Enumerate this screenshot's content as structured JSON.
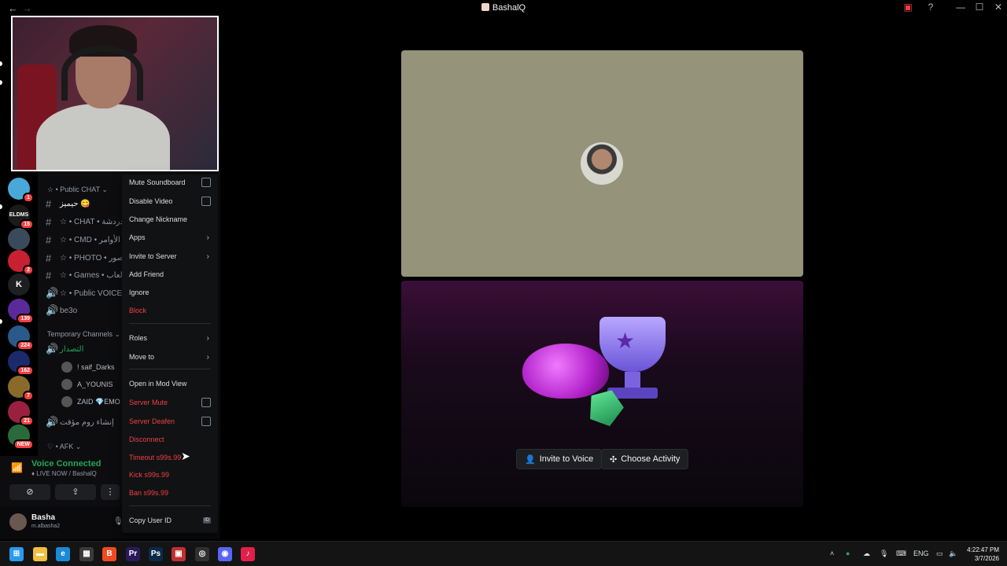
{
  "window": {
    "title": "BashalQ",
    "back_glyph": "←",
    "forward_glyph": "→",
    "controls": {
      "inbox_icon": "inbox-icon",
      "help": "?",
      "minimize": "—",
      "maximize": "☐",
      "close": "✕"
    }
  },
  "servers": [
    {
      "name": "server-1",
      "color": "#4aa8d8",
      "badge": "1"
    },
    {
      "name": "server-2",
      "color": "#1a1a1a",
      "label": "ELDMS",
      "badge": "15"
    },
    {
      "name": "server-3",
      "color": "#3a4a5a"
    },
    {
      "name": "server-4",
      "color": "#c82030",
      "badge": "2"
    },
    {
      "name": "server-5",
      "color": "#1e1f22",
      "label": "K"
    },
    {
      "name": "server-6",
      "color": "#5a2a9a",
      "badge": "139"
    },
    {
      "name": "server-7",
      "color": "#2a5a8a",
      "badge": "224"
    },
    {
      "name": "server-8",
      "color": "#1a2a6a",
      "badge": "162"
    },
    {
      "name": "server-9",
      "color": "#8a6a2a",
      "badge": "7"
    },
    {
      "name": "server-10",
      "color": "#9a2040",
      "badge": "21"
    },
    {
      "name": "server-11",
      "color": "#2a6a3a",
      "badge": "NEW"
    }
  ],
  "channels": {
    "category_public": "☆ • Public CHAT ⌄",
    "items": [
      {
        "label": "حيميز 😋",
        "type": "text",
        "active": true
      },
      {
        "label": "☆ • CHAT • دردشة",
        "type": "text"
      },
      {
        "label": "☆ • CMD • الأوامر",
        "type": "text"
      },
      {
        "label": "☆ • PHOTO • صور",
        "type": "text"
      },
      {
        "label": "☆ • Games • ألعاب",
        "type": "text"
      },
      {
        "label": "☆ • Public VOICE",
        "type": "voice"
      },
      {
        "label": "be3o",
        "type": "voice"
      }
    ],
    "category_temp": "Temporary Channels ⌄",
    "temp_channel": "التصدار",
    "voice_users": [
      "! saif_Darks",
      "A_YOUNIS",
      "ZAID 💎EMO"
    ],
    "create_temp": "إنشاء روم مؤقت",
    "category_afk": "♡ • AFK ⌄"
  },
  "voice": {
    "title": "Voice Connected",
    "subtitle": "♦ LIVE NOW / BashalQ",
    "buttons": [
      "camera-off-icon",
      "screen-share-icon",
      "more-icon"
    ]
  },
  "user": {
    "name": "Basha",
    "tag": "m.albasha2"
  },
  "menu": {
    "mute_soundboard": "Mute Soundboard",
    "disable_video": "Disable Video",
    "change_nickname": "Change Nickname",
    "apps": "Apps",
    "invite_to_server": "Invite to Server",
    "add_friend": "Add Friend",
    "ignore": "Ignore",
    "block": "Block",
    "roles": "Roles",
    "move_to": "Move to",
    "open_mod_view": "Open in Mod View",
    "server_mute": "Server Mute",
    "server_deafen": "Server Deafen",
    "disconnect": "Disconnect",
    "timeout": "Timeout s99s.99",
    "kick": "Kick s99s.99",
    "ban": "Ban s99s.99",
    "copy_user_id": "Copy User ID",
    "id_badge": "ID"
  },
  "stage": {
    "invite_to_voice": "Invite to Voice",
    "choose_activity": "Choose Activity"
  },
  "taskbar": {
    "language": "ENG",
    "time": "4:22:47 PM",
    "date": "3/7/2026",
    "apps": [
      {
        "name": "windows-start",
        "color": "#2a9af0",
        "glyph": "⊞"
      },
      {
        "name": "file-explorer",
        "color": "#f0c040",
        "glyph": "▬"
      },
      {
        "name": "edge",
        "color": "#1a8ad8",
        "glyph": "e"
      },
      {
        "name": "microsoft-store",
        "color": "#3a3a3a",
        "glyph": "▦"
      },
      {
        "name": "brave",
        "color": "#f04a20",
        "glyph": "B"
      },
      {
        "name": "premiere",
        "color": "#2a1a5a",
        "glyph": "Pr"
      },
      {
        "name": "photoshop",
        "color": "#0a2a4a",
        "glyph": "Ps"
      },
      {
        "name": "app-8",
        "color": "#c03030",
        "glyph": "▣"
      },
      {
        "name": "app-9",
        "color": "#303030",
        "glyph": "◎"
      },
      {
        "name": "discord",
        "color": "#5865f2",
        "glyph": "◉"
      },
      {
        "name": "tiktok",
        "color": "#e0204a",
        "glyph": "♪"
      }
    ]
  }
}
